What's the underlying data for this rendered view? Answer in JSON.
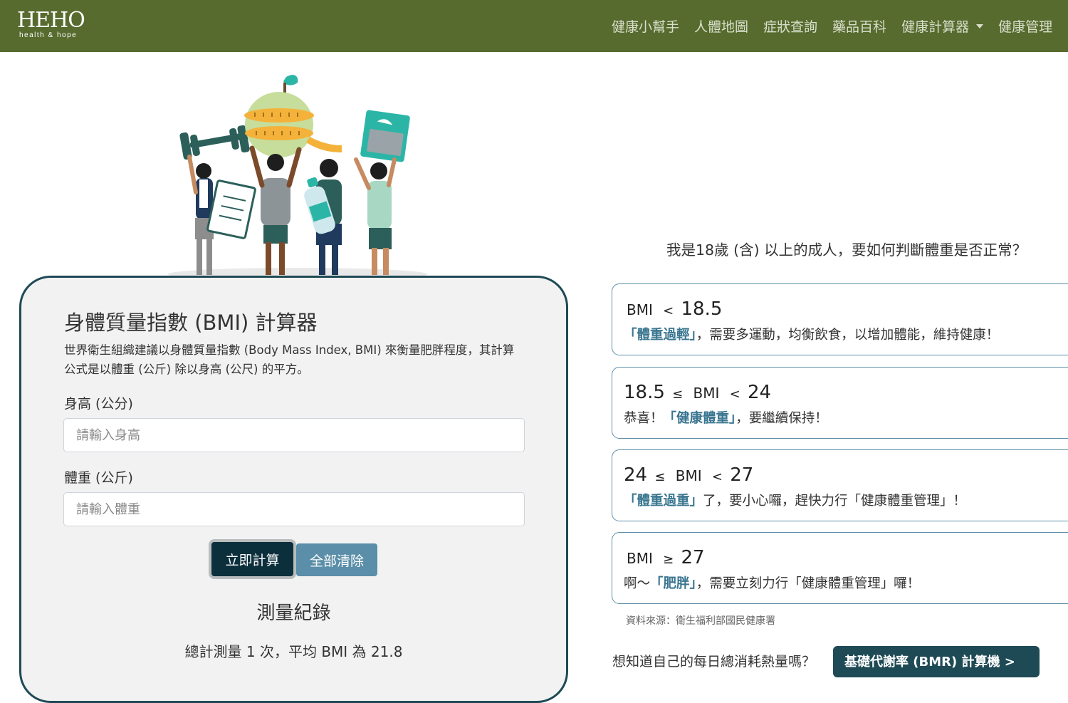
{
  "header": {
    "logo": {
      "wordmark": "HEHO",
      "tagline": "health & hope"
    },
    "nav": [
      {
        "label": "健康小幫手"
      },
      {
        "label": "人體地圖"
      },
      {
        "label": "症狀查詢"
      },
      {
        "label": "藥品百科"
      },
      {
        "label": "健康計算器",
        "dropdown": true
      },
      {
        "label": "健康管理"
      }
    ],
    "colors": {
      "background": "#576b2e",
      "text": "#d9dfcc"
    }
  },
  "calculator": {
    "title": "身體質量指數 (BMI) 計算器",
    "description": "世界衛生組織建議以身體質量指數 (Body Mass Index, BMI) 來衡量肥胖程度，其計算公式是以體重 (公斤) 除以身高 (公尺) 的平方。",
    "height": {
      "label": "身高 (公分)",
      "placeholder": "請輸入身高",
      "value": ""
    },
    "weight": {
      "label": "體重 (公斤)",
      "placeholder": "請輸入體重",
      "value": ""
    },
    "buttons": {
      "calculate": "立即計算",
      "clear": "全部清除"
    },
    "record": {
      "title": "測量紀錄",
      "summary": "總計測量 1 次，平均 BMI 為 21.8"
    },
    "colors": {
      "border": "#1e4a55",
      "calculate_button": "#0c2f3c",
      "clear_button": "#5b8ea8"
    }
  },
  "guidance": {
    "question": "我是18歲 (含) 以上的成人，要如何判斷體重是否正常？",
    "ranges": [
      {
        "lower": "",
        "lower_symbol": "",
        "label": "BMI",
        "upper_symbol": "<",
        "upper": "18.5",
        "advice_before": "",
        "highlight": "「體重過輕」",
        "advice_after": "，需要多運動，均衡飲食，以增加體能，維持健康！"
      },
      {
        "lower": "18.5",
        "lower_symbol": "≤",
        "label": "BMI",
        "upper_symbol": "<",
        "upper": "24",
        "advice_before": "恭喜！",
        "highlight": "「健康體重」",
        "advice_after": "，要繼續保持！"
      },
      {
        "lower": "24",
        "lower_symbol": "≤",
        "label": "BMI",
        "upper_symbol": "<",
        "upper": "27",
        "advice_before": "",
        "highlight": "「體重過重」",
        "advice_after": "了，要小心囉，趕快力行「健康體重管理」！"
      },
      {
        "lower": "",
        "lower_symbol": "",
        "label": "BMI",
        "upper_symbol": "≥",
        "upper": "27",
        "advice_before": "啊～",
        "highlight": "「肥胖」",
        "advice_after": "，需要立刻力行「健康體重管理」囉！"
      }
    ],
    "source": "資料來源：衛生福利部國民健康署",
    "bmr_prompt": "想知道自己的每日總消耗熱量嗎？",
    "bmr_button": "基礎代謝率 (BMR) 計算機 >",
    "colors": {
      "card_border": "#5b8ea8",
      "highlight": "#3a7690",
      "bmr_button": "#1e4a55"
    }
  },
  "hero": {
    "icons": [
      "dumbbell-icon",
      "apple-with-measuring-tape-icon",
      "scale-icon",
      "clipboard-icon",
      "water-bottle-icon"
    ]
  }
}
